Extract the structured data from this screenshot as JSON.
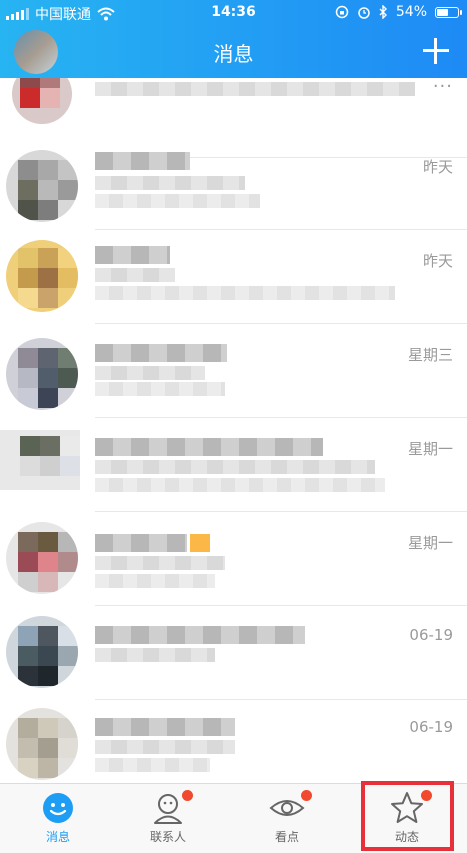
{
  "status_bar": {
    "carrier": "中国联通",
    "time": "14:36",
    "battery": "54%"
  },
  "header": {
    "title": "消息"
  },
  "conversations": [
    {
      "time": ""
    },
    {
      "time": "昨天"
    },
    {
      "time": "昨天"
    },
    {
      "time": "星期三"
    },
    {
      "time": "星期一"
    },
    {
      "time": "星期一"
    },
    {
      "time": "06-19"
    },
    {
      "time": "06-19"
    }
  ],
  "tabs": [
    {
      "label": "消息"
    },
    {
      "label": "联系人"
    },
    {
      "label": "看点"
    },
    {
      "label": "动态"
    }
  ],
  "colors": {
    "header": "#1e8af5",
    "active_tab": "#1e9df5",
    "badge": "#f0492f",
    "highlight": "#e8303a"
  }
}
